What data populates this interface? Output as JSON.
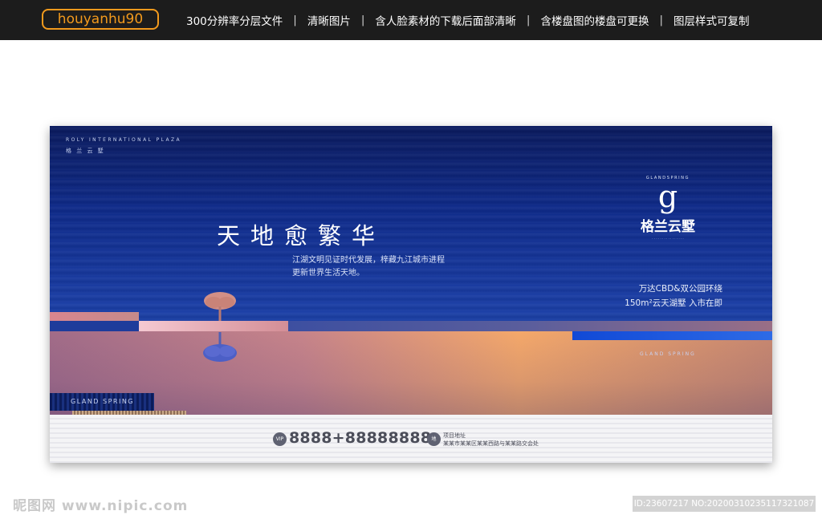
{
  "header": {
    "username": "houyanhu90",
    "features": [
      "300分辨率分层文件",
      "清晰图片",
      "含人脸素材的下载后面部清晰",
      "含楼盘图的楼盘可更换",
      "图层样式可复制"
    ],
    "separator": "|"
  },
  "poster": {
    "brand_en": "ROLY INTERNATIONAL PLAZA",
    "brand_cn": "格 兰 云 墅",
    "headline": "天地愈繁华",
    "subline1": "江湖文明见证时代发展，梓藏九江城市进程",
    "subline2": "更新世界生活天地。",
    "logo_arc": "GLANDSPRING",
    "logo_letter": "g",
    "logo_cn": "格兰云墅",
    "promo1": "万达CBD&双公园环绕",
    "promo2": "150m²云天湖墅  入市在即",
    "gland_mid": "GLAND SPRING",
    "gland_box": "GLAND SPRING",
    "vip_label": "VIP",
    "phone": "8888+88888888",
    "addr_badge": "地",
    "addr_label": "项目地址",
    "addr_text": "某某市某某区某某西路与某某路交会处"
  },
  "footer": {
    "watermark": "昵图网 www.nipic.com",
    "id_line": "ID:23607217 NO:20200310235117321087"
  },
  "colors": {
    "accent_orange": "#f29a1d",
    "poster_blue": "#0e2a8a"
  }
}
